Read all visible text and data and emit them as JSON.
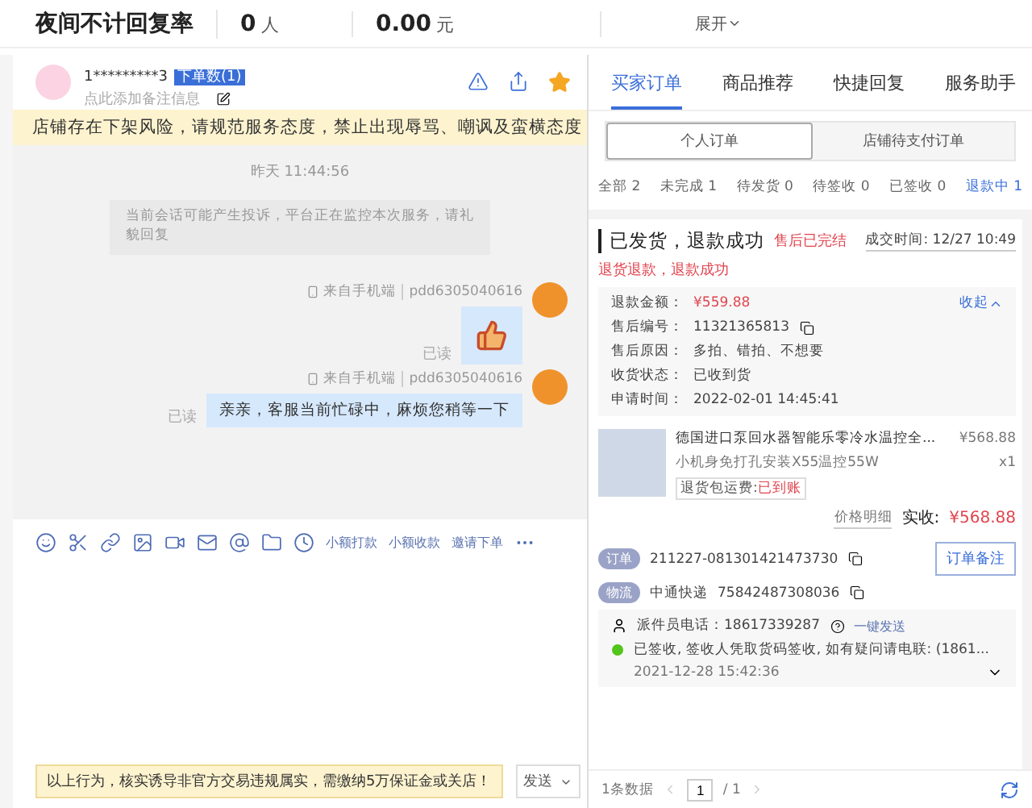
{
  "stats": [
    {
      "value": "夜间不计回复率"
    },
    {
      "value": "0",
      "unit": "人"
    },
    {
      "value": "0.00",
      "unit": "元"
    }
  ],
  "expand": "展开",
  "chat": {
    "user": "1*********3",
    "order_badge": "下单数(1)",
    "note_placeholder": "点此添加备注信息",
    "starred": true,
    "warning": "店铺存在下架风险，请规范服务态度，禁止出现辱骂、嘲讽及蛮横态度",
    "time": "昨天 11:44:56",
    "system_notice": "当前会话可能产生投诉，平台正在监控本次服务，请礼貌回复",
    "messages": [
      {
        "kind": "image",
        "source": "来自手机端",
        "sender": "pdd6305040616",
        "read": "已读"
      },
      {
        "kind": "text",
        "source": "来自手机端",
        "sender": "pdd6305040616",
        "read": "已读",
        "text": "亲亲，客服当前忙碌中，麻烦您稍等一下"
      }
    ]
  },
  "toolbar": {
    "links": [
      "小额打款",
      "小额收款",
      "邀请下单"
    ]
  },
  "compliance_notice": "以上行为，核实诱导非官方交易违规属实，需缴纳5万保证金或关店！",
  "send": "发送",
  "tabs": [
    {
      "label": "买家订单",
      "selected": true
    },
    {
      "label": "商品推荐",
      "selected": false
    },
    {
      "label": "快捷回复",
      "selected": false
    },
    {
      "label": "服务助手",
      "selected": false
    }
  ],
  "subtabs": [
    {
      "label": "个人订单",
      "selected": true
    },
    {
      "label": "店铺待支付订单",
      "selected": false
    }
  ],
  "filters": [
    {
      "label": "全部 2",
      "selected": false
    },
    {
      "label": "未完成 1",
      "selected": false
    },
    {
      "label": "待发货 0",
      "selected": false
    },
    {
      "label": "待签收 0",
      "selected": false
    },
    {
      "label": "已签收 0",
      "selected": false
    },
    {
      "label": "退款中 1",
      "selected": true
    }
  ],
  "order": {
    "status": "已发货，退款成功",
    "aftersale_status": "售后已完结",
    "deal_time": "成交时间: 12/27 10:49",
    "refund_type": "退货退款，退款成功",
    "details": [
      {
        "label": "退款金额：",
        "value": "¥559.88",
        "emphasis": true
      },
      {
        "label": "售后编号：",
        "value": "11321365813",
        "emphasis": false,
        "copy": true
      },
      {
        "label": "售后原因：",
        "value": "多拍、错拍、不想要",
        "emphasis": false
      },
      {
        "label": "收货状态：",
        "value": "已收到货",
        "emphasis": false
      },
      {
        "label": "申请时间：",
        "value": "2022-02-01 14:45:41",
        "emphasis": false
      }
    ],
    "collapse": "收起",
    "product": {
      "title": "德国进口泵回水器智能乐零冷水温控全...",
      "price": "¥568.88",
      "spec": "小机身免打孔安装X55温控55W",
      "qty": "x1",
      "shipping_label": "退货包运费:",
      "shipping_value": "已到账"
    },
    "price_detail": "价格明细",
    "paid_label": "实收:",
    "paid": "¥568.88",
    "order_tag": "订单",
    "order_no": "211227-081301421473730",
    "remark_button": "订单备注",
    "logistics_tag": "物流",
    "carrier": "中通快递",
    "tracking": "75842487308036",
    "courier_label": "派件员电话：",
    "courier_phone": "18617339287",
    "send_link": "一键发送",
    "track_text": "已签收, 签收人凭取货码签收, 如有疑问请电联: (1861...",
    "track_time": "2021-12-28 15:42:36"
  },
  "pagination": {
    "total": "1条数据",
    "page": "1",
    "pages": "/ 1"
  }
}
